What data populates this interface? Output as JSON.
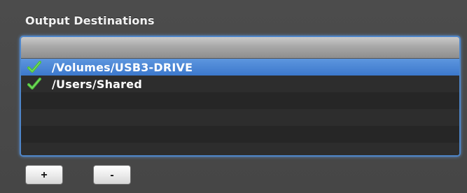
{
  "section": {
    "title": "Output Destinations"
  },
  "destinations": {
    "rows": [
      {
        "path": "/Volumes/USB3-DRIVE",
        "checked": true,
        "selected": true,
        "icon": "checkmark-icon"
      },
      {
        "path": "/Users/Shared",
        "checked": true,
        "selected": false,
        "icon": "checkmark-icon"
      }
    ]
  },
  "buttons": {
    "add_label": "+",
    "remove_label": "-"
  },
  "colors": {
    "selection": "#4a86d6",
    "focus_ring": "#4f86c9",
    "check": "#4fbf3a",
    "background": "#4a4a4a"
  }
}
